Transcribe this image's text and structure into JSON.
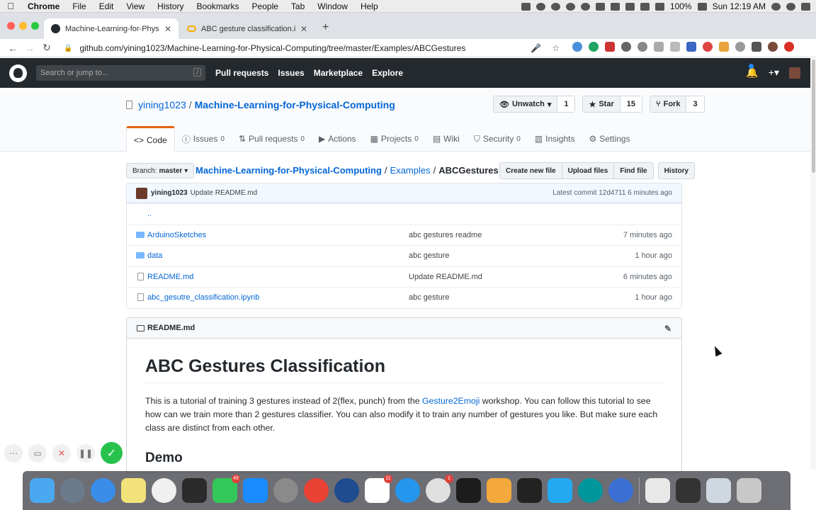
{
  "menubar": {
    "app": "Chrome",
    "items": [
      "File",
      "Edit",
      "View",
      "History",
      "Bookmarks",
      "People",
      "Tab",
      "Window",
      "Help"
    ],
    "battery": "100%",
    "clock": "Sun 12:19 AM"
  },
  "tabs": [
    {
      "title": "Machine-Learning-for-Physical-"
    },
    {
      "title": "ABC gesture classification.ipynb"
    }
  ],
  "toolbar": {
    "url": "github.com/yining1023/Machine-Learning-for-Physical-Computing/tree/master/Examples/ABCGestures"
  },
  "gh": {
    "search_placeholder": "Search or jump to...",
    "search_key": "/",
    "nav": [
      "Pull requests",
      "Issues",
      "Marketplace",
      "Explore"
    ]
  },
  "repo": {
    "owner": "yining1023",
    "separator": "/",
    "name": "Machine-Learning-for-Physical-Computing",
    "watch_label": "Unwatch",
    "watch_count": "1",
    "star_label": "Star",
    "star_count": "15",
    "fork_label": "Fork",
    "fork_count": "3",
    "tabs": [
      {
        "label": "Code",
        "count": ""
      },
      {
        "label": "Issues",
        "count": "0"
      },
      {
        "label": "Pull requests",
        "count": "0"
      },
      {
        "label": "Actions",
        "count": ""
      },
      {
        "label": "Projects",
        "count": "0"
      },
      {
        "label": "Wiki",
        "count": ""
      },
      {
        "label": "Security",
        "count": "0"
      },
      {
        "label": "Insights",
        "count": ""
      },
      {
        "label": "Settings",
        "count": ""
      }
    ]
  },
  "filenav": {
    "branch_label": "Branch:",
    "branch": "master",
    "crumb_root": "Machine-Learning-for-Physical-Computing",
    "crumb_mid": "Examples",
    "crumb_final": "ABCGestures",
    "sep": "/",
    "buttons": [
      "Create new file",
      "Upload files",
      "Find file",
      "History"
    ]
  },
  "commit": {
    "author": "yining1023",
    "message": "Update README.md",
    "latest": "Latest commit 12d4711 6 minutes ago"
  },
  "files": [
    {
      "name": "..",
      "message": "",
      "age": "",
      "type": "up"
    },
    {
      "name": "ArduinoSketches",
      "message": "abc gestures readme",
      "age": "7 minutes ago",
      "type": "folder"
    },
    {
      "name": "data",
      "message": "abc gesture",
      "age": "1 hour ago",
      "type": "folder"
    },
    {
      "name": "README.md",
      "message": "Update README.md",
      "age": "6 minutes ago",
      "type": "file"
    },
    {
      "name": "abc_gesutre_classification.ipynb",
      "message": "abc gesture",
      "age": "1 hour ago",
      "type": "file"
    }
  ],
  "readme": {
    "filename": "README.md",
    "title": "ABC Gestures Classification",
    "para_before": "This is a tutorial of training 3 gestures instead of 2(flex, punch) from the ",
    "link": "Gesture2Emoji",
    "para_after": " workshop. You can follow this tutorial to see how can we train more than 2 gestures classifier. You can also modify it to train any number of gestures you like. But make sure each class are distinct from each other.",
    "h2": "Demo"
  },
  "dock": {
    "badges": {
      "facetime": "49",
      "notion": "11",
      "slack": "1"
    }
  },
  "colors": {
    "github_dark": "#24292e",
    "link": "#0366d6",
    "code_tab_accent": "#e36209",
    "record_green": "#27c24c"
  }
}
